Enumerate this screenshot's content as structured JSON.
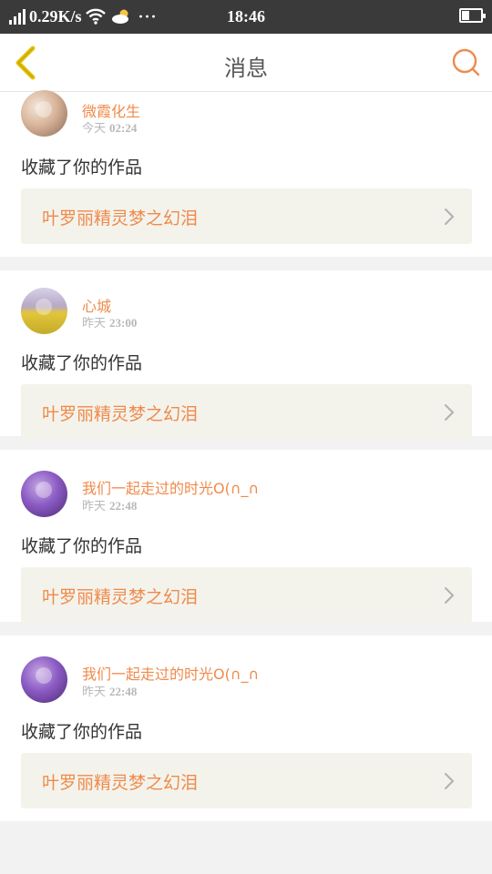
{
  "status_bar": {
    "net_speed": "0.29K/s",
    "time": "18:46",
    "more": "···",
    "icons": [
      "signal-icon",
      "wifi-icon",
      "weather-icon",
      "battery-icon"
    ]
  },
  "header": {
    "title": "消息",
    "back_icon": "chevron-left-icon",
    "search_icon": "search-icon",
    "accent_color": "#f08a4b",
    "back_color": "#e6c200"
  },
  "messages": [
    {
      "username": "微霞化生",
      "date_label": "今天",
      "time": "02:24",
      "action": "收藏了你的作品",
      "work_title": "叶罗丽精灵梦之幻泪"
    },
    {
      "username": "心城",
      "date_label": "昨天",
      "time": "23:00",
      "action": "收藏了你的作品",
      "work_title": "叶罗丽精灵梦之幻泪"
    },
    {
      "username": "我们一起走过的时光O(∩_∩",
      "date_label": "昨天",
      "time": "22:48",
      "action": "收藏了你的作品",
      "work_title": "叶罗丽精灵梦之幻泪"
    },
    {
      "username": "我们一起走过的时光O(∩_∩",
      "date_label": "昨天",
      "time": "22:48",
      "action": "收藏了你的作品",
      "work_title": "叶罗丽精灵梦之幻泪"
    }
  ]
}
